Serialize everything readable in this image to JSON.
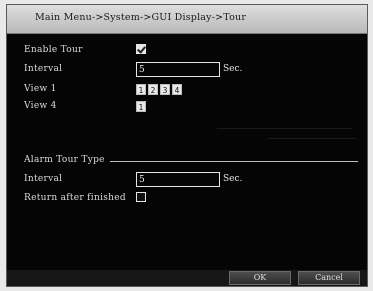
{
  "title": "Main Menu->System->GUI Display->Tour",
  "tour": {
    "enable_label": "Enable Tour",
    "enable_checked": true,
    "interval_label": "Interval",
    "interval_value": "5",
    "interval_unit": "Sec.",
    "view1_label": "View 1",
    "view1_channels": [
      "1",
      "2",
      "3",
      "4"
    ],
    "view4_label": "View 4",
    "view4_channels": [
      "1"
    ]
  },
  "alarm": {
    "section_label": "Alarm Tour Type",
    "interval_label": "Interval",
    "interval_value": "5",
    "interval_unit": "Sec.",
    "return_label": "Return after finished",
    "return_checked": false
  },
  "buttons": {
    "ok": "OK",
    "cancel": "Cancel"
  }
}
